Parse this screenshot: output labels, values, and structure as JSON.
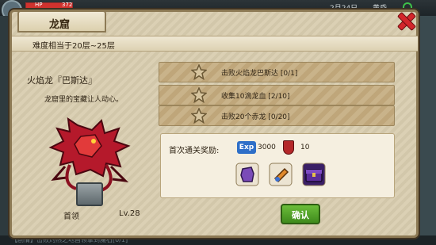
{
  "hud": {
    "hp_label": "HP",
    "hp_value": "372",
    "date": "2月24日",
    "season": "黄昏"
  },
  "panel": {
    "title": "龙窟",
    "difficulty": "难度相当于20层~25层"
  },
  "boss": {
    "name": "火焰龙『巴斯达』",
    "description": "龙窟里的宝藏让人动心。",
    "rank": "首领",
    "level": "Lv.28"
  },
  "quests": [
    {
      "text": "击败火焰龙巴斯达 [0/1]"
    },
    {
      "text": "收集10滴龙血 [2/10]"
    },
    {
      "text": "击败20个赤龙 [0/20]"
    }
  ],
  "rewards": {
    "title": "首次通关奖励:",
    "exp_icon": "Exp",
    "exp_value": "3000",
    "rep_value": "10",
    "items": [
      {
        "icon": "purple-gauntlet-icon",
        "color": "#7a4bb8"
      },
      {
        "icon": "orange-scroll-icon",
        "color": "#e0892c"
      },
      {
        "icon": "purple-chest-icon",
        "color": "#5b2d9a"
      }
    ]
  },
  "buttons": {
    "confirm": "确认"
  },
  "bottom_log": "【剧情】击败灼热之地首领拿到魔石[0/1]",
  "colors": {
    "panel": "#d9cdb0",
    "quest": "#c9b38a",
    "confirm": "#4f9e28",
    "close": "#d3262b"
  }
}
